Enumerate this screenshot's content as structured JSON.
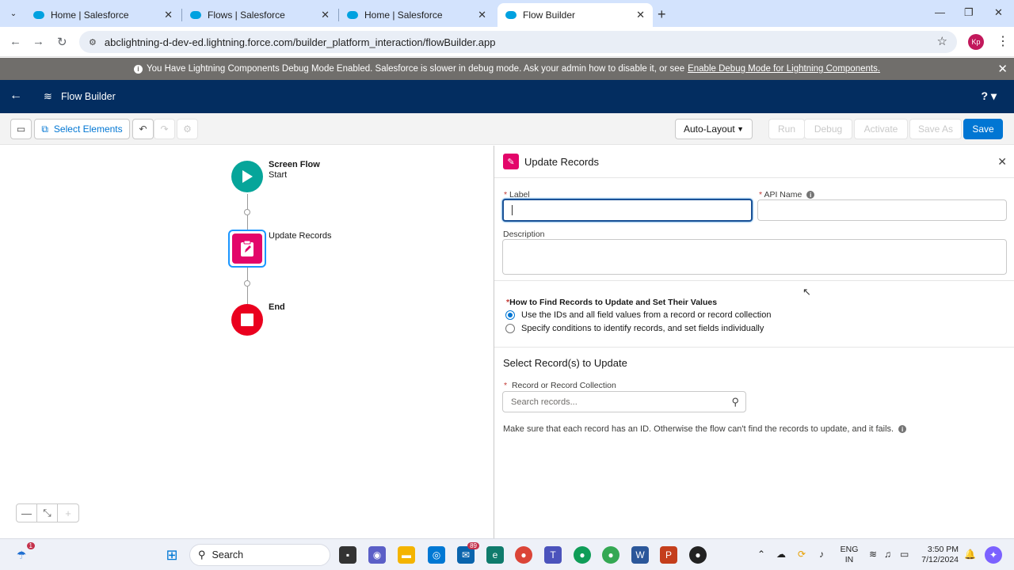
{
  "browser": {
    "tabs": [
      {
        "title": "Home | Salesforce",
        "active": false
      },
      {
        "title": "Flows | Salesforce",
        "active": false
      },
      {
        "title": "Home | Salesforce",
        "active": false
      },
      {
        "title": "Flow Builder",
        "active": true
      }
    ],
    "url": "abclightning-d-dev-ed.lightning.force.com/builder_platform_interaction/flowBuilder.app",
    "profile_initials": "Kp"
  },
  "banner": {
    "message": "You Have Lightning Components Debug Mode Enabled. Salesforce is slower in debug mode. Ask your admin how to disable it, or see",
    "link": "Enable Debug Mode for Lightning Components."
  },
  "header": {
    "title": "Flow Builder",
    "help": "?"
  },
  "toolbar": {
    "select_elements": "Select Elements",
    "layout": "Auto-Layout",
    "run": "Run",
    "debug": "Debug",
    "activate": "Activate",
    "save_as": "Save As",
    "save": "Save"
  },
  "canvas": {
    "start_title": "Screen Flow",
    "start_subtitle": "Start",
    "update_label": "Update Records",
    "end_label": "End",
    "zoom_out": "—",
    "fit": "⤡",
    "zoom_in": "+"
  },
  "panel": {
    "title": "Update Records",
    "label_field": {
      "label": "Label",
      "value": ""
    },
    "api_field": {
      "label": "API Name",
      "value": ""
    },
    "description_label": "Description",
    "find_question": "How to Find Records to Update and Set Their Values",
    "options": [
      {
        "label": "Use the IDs and all field values from a record or record collection",
        "checked": true
      },
      {
        "label": "Specify conditions to identify records, and set fields individually",
        "checked": false
      }
    ],
    "section_title": "Select Record(s) to Update",
    "record_field_label": "Record or Record Collection",
    "search_placeholder": "Search records...",
    "help_text": "Make sure that each record has an ID. Otherwise the flow can't find the records to update, and it fails."
  },
  "taskbar": {
    "search": "Search",
    "mail_badge": "89",
    "weather_badge": "1",
    "lang_top": "ENG",
    "lang_bottom": "IN",
    "time": "3:50 PM",
    "date": "7/12/2024"
  }
}
